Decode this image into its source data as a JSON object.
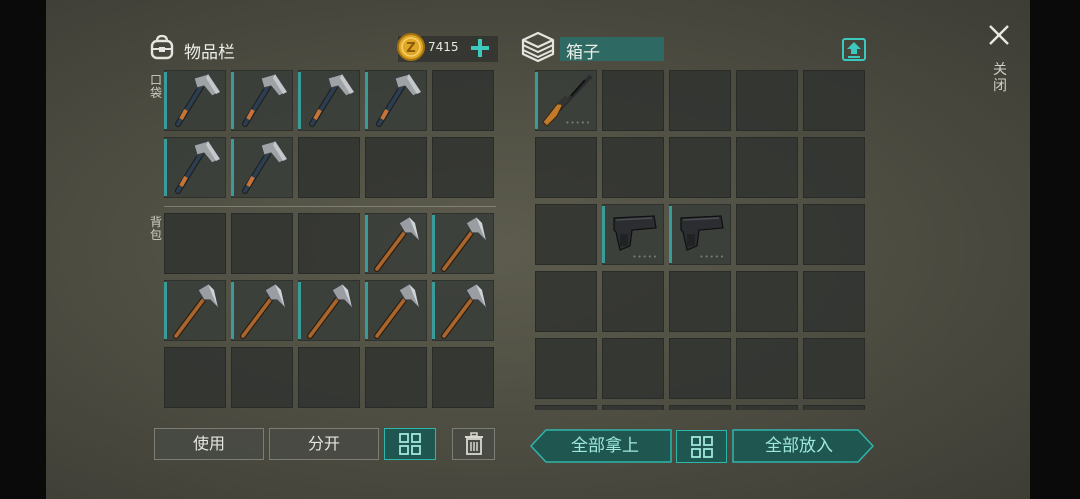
{
  "inventory": {
    "title": "物品栏",
    "currency_amount": "7415",
    "pocket_label": "口袋",
    "backpack_label": "背包",
    "pocket_slots": [
      "axe",
      "axe",
      "axe",
      "axe",
      "",
      "axe",
      "axe",
      "",
      "",
      ""
    ],
    "backpack_slots": [
      "",
      "",
      "",
      "pickaxe",
      "pickaxe",
      "pickaxe",
      "pickaxe",
      "pickaxe",
      "pickaxe",
      "pickaxe",
      "",
      "",
      "",
      "",
      ""
    ]
  },
  "box": {
    "title": "箱子",
    "slots": [
      "rifle",
      "",
      "",
      "",
      "",
      "",
      "",
      "",
      "",
      "",
      "",
      "pistol",
      "pistol",
      "",
      "",
      "",
      "",
      "",
      "",
      "",
      "",
      "",
      "",
      "",
      "",
      "",
      "",
      "",
      "",
      ""
    ]
  },
  "actions": {
    "use": "使用",
    "split": "分开",
    "take_all": "全部拿上",
    "put_all": "全部放入"
  },
  "close": {
    "label": "关闭"
  },
  "colors": {
    "accent": "#2fb5ac",
    "teal_bg": "#1f5650",
    "coin": "#e0a626"
  },
  "icons": [
    "backpack-icon",
    "coin-icon",
    "plus-icon",
    "box-icon",
    "upload-icon",
    "close-icon",
    "grid-icon",
    "trash-icon"
  ]
}
